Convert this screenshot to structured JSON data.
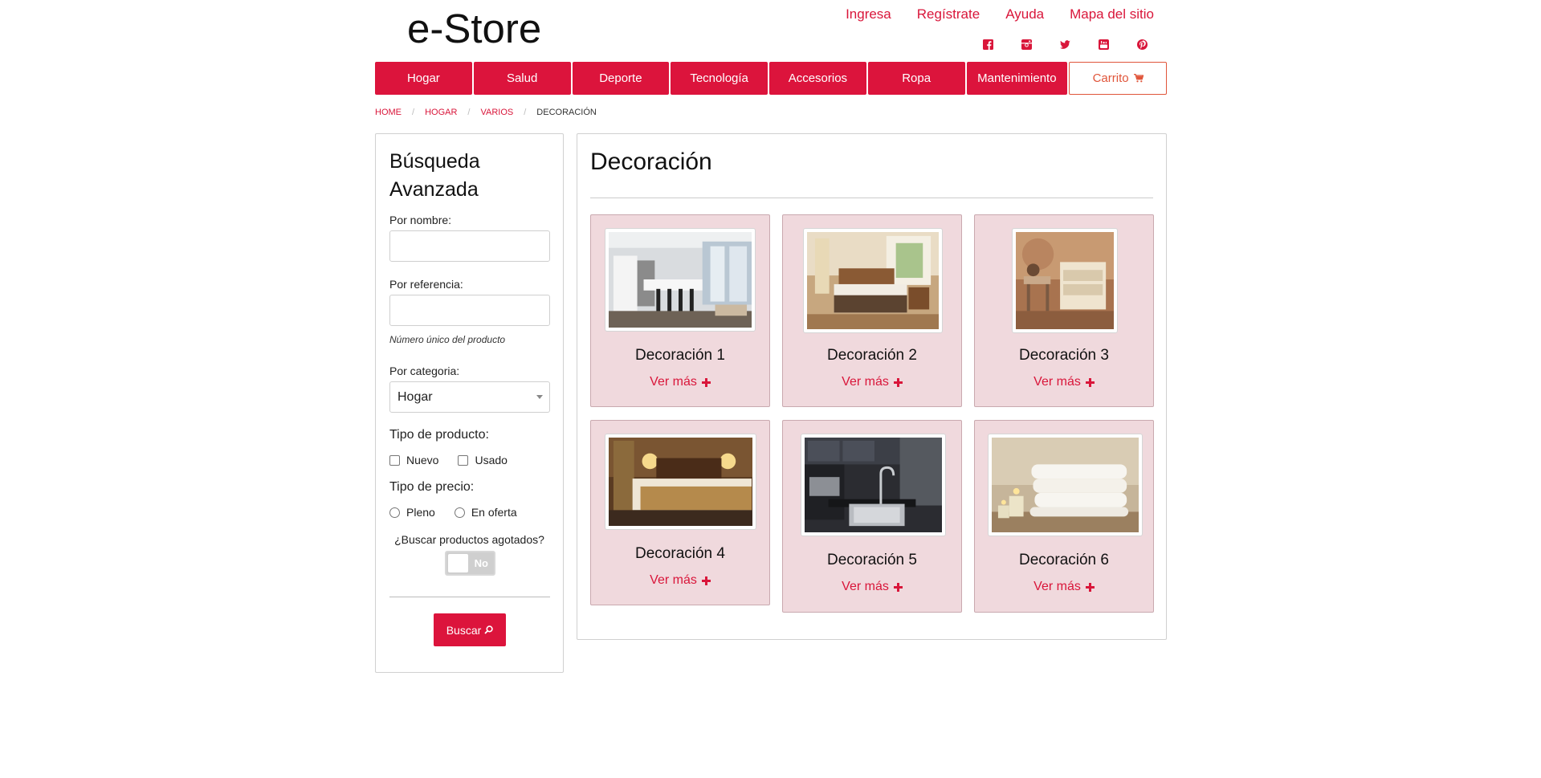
{
  "brand": "e-Store",
  "top_links": [
    "Ingresa",
    "Regístrate",
    "Ayuda",
    "Mapa del sitio"
  ],
  "social_icons": [
    "facebook-icon",
    "instagram-icon",
    "twitter-icon",
    "youtube-icon",
    "pinterest-icon"
  ],
  "nav": {
    "items": [
      "Hogar",
      "Salud",
      "Deporte",
      "Tecnología",
      "Accesorios",
      "Ropa",
      "Mantenimiento"
    ],
    "cart_label": "Carrito"
  },
  "breadcrumb": [
    "HOME",
    "HOGAR",
    "VARIOS",
    "DECORACIÓN"
  ],
  "sidebar": {
    "title": "Búsqueda Avanzada",
    "name_label": "Por nombre:",
    "name_value": "",
    "ref_label": "Por referencia:",
    "ref_value": "",
    "ref_hint": "Número único del producto",
    "category_label": "Por categoria:",
    "category_value": "Hogar",
    "product_type_label": "Tipo de producto:",
    "product_types": [
      "Nuevo",
      "Usado"
    ],
    "price_type_label": "Tipo de precio:",
    "price_types": [
      "Pleno",
      "En oferta"
    ],
    "out_of_stock_question": "¿Buscar productos agotados?",
    "toggle_label": "No",
    "search_button": "Buscar"
  },
  "main": {
    "title": "Decoración",
    "more_label": "Ver más",
    "products": [
      {
        "name": "Decoración 1"
      },
      {
        "name": "Decoración 2"
      },
      {
        "name": "Decoración 3"
      },
      {
        "name": "Decoración 4"
      },
      {
        "name": "Decoración 5"
      },
      {
        "name": "Decoración 6"
      }
    ]
  },
  "colors": {
    "accent": "#dc143c",
    "card_bg": "#f0d9dd",
    "cart_border": "#e0553a"
  }
}
